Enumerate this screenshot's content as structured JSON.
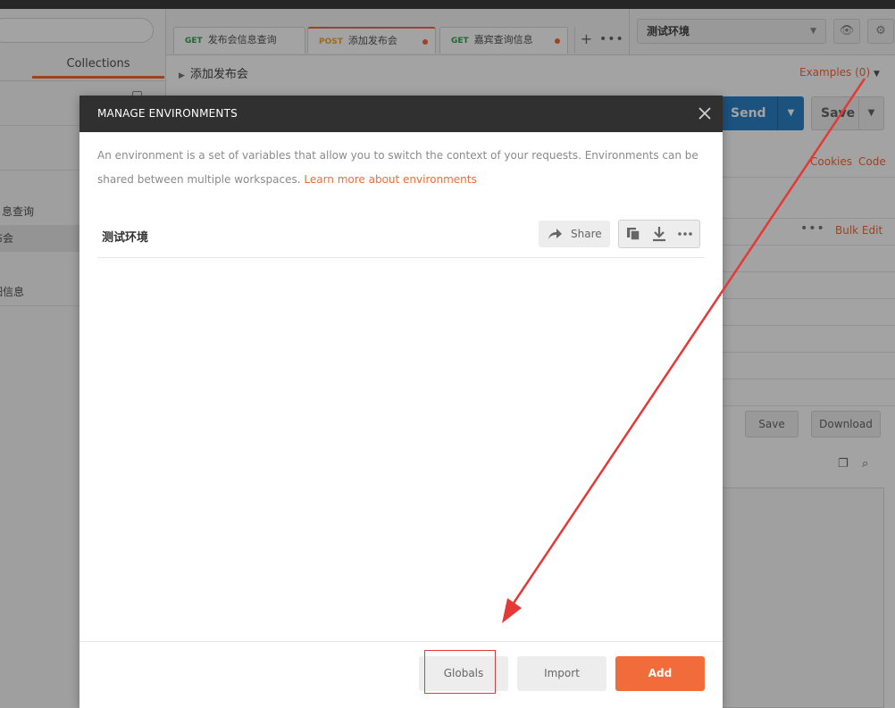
{
  "sidebar": {
    "tab_label": "Collections",
    "items": [
      "息查询",
      "布会",
      "细信息"
    ]
  },
  "request_tabs": [
    {
      "method": "GET",
      "name": "发布会信息查询"
    },
    {
      "method": "POST",
      "name": "添加发布会"
    },
    {
      "method": "GET",
      "name": "嘉宾查询信息"
    }
  ],
  "environment_selector": {
    "value": "测试环境"
  },
  "request": {
    "title": "添加发布会",
    "examples_label": "Examples (0)",
    "send_label": "Send",
    "save_label": "Save",
    "cookies_label": "Cookies",
    "code_label": "Code",
    "bulk_edit_label": "Bulk Edit"
  },
  "response": {
    "save_label": "Save",
    "download_label": "Download"
  },
  "modal": {
    "title": "MANAGE ENVIRONMENTS",
    "description": "An environment is a set of variables that allow you to switch the context of your requests. Environments can be shared between multiple workspaces.",
    "learn_more": "Learn more about environments",
    "environments": [
      {
        "name": "测试环境"
      }
    ],
    "share_label": "Share",
    "globals_label": "Globals",
    "import_label": "Import",
    "add_label": "Add"
  },
  "colors": {
    "accent": "#f26b3a",
    "send": "#2b80c5",
    "header": "#303030",
    "annotation": "#e53935"
  }
}
